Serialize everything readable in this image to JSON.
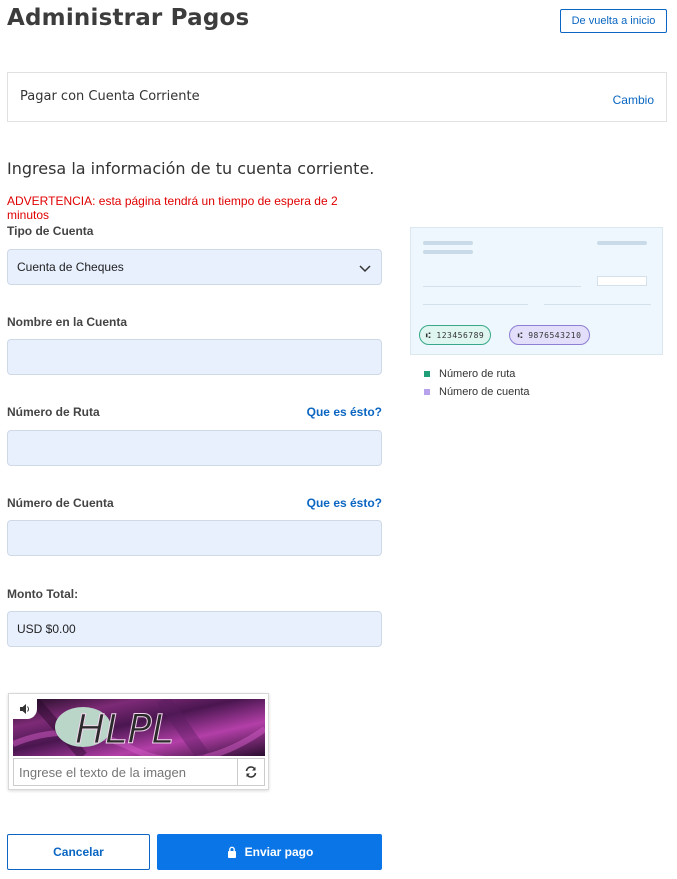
{
  "header": {
    "title": "Administrar Pagos",
    "back_label": "De vuelta a inicio"
  },
  "payment_method": {
    "label": "Pagar con Cuenta Corriente",
    "change_label": "Cambio"
  },
  "form": {
    "heading": "Ingresa la información de tu cuenta corriente.",
    "warning": "ADVERTENCIA: esta página tendrá un tiempo de espera de 2 minutos",
    "account_type": {
      "label": "Tipo de Cuenta",
      "value": "Cuenta de Cheques"
    },
    "account_name": {
      "label": "Nombre en la Cuenta",
      "value": ""
    },
    "routing_number": {
      "label": "Número de Ruta",
      "help": "Que es ésto?",
      "value": ""
    },
    "account_number": {
      "label": "Número de Cuenta",
      "help": "Que es ésto?",
      "value": ""
    },
    "total": {
      "label": "Monto Total:",
      "value": "USD $0.00"
    }
  },
  "check_example": {
    "routing_sample": "⑆ 123456789",
    "account_sample": "⑆ 9876543210",
    "legend": [
      {
        "label": "Número de ruta",
        "color": "#1f9e78"
      },
      {
        "label": "Número de cuenta",
        "color": "#b7a2ec"
      }
    ]
  },
  "captcha": {
    "image_text": "HLPL",
    "placeholder": "Ingrese el texto de la imagen",
    "audio_icon": "speaker-icon",
    "refresh_icon": "refresh-icon"
  },
  "actions": {
    "cancel_label": "Cancelar",
    "submit_label": "Enviar pago",
    "submit_icon": "lock-icon"
  },
  "colors": {
    "accent": "#0a66c2",
    "primary_button": "#0a75e6",
    "warning": "#e00000",
    "field_bg": "#e8f0fe"
  }
}
